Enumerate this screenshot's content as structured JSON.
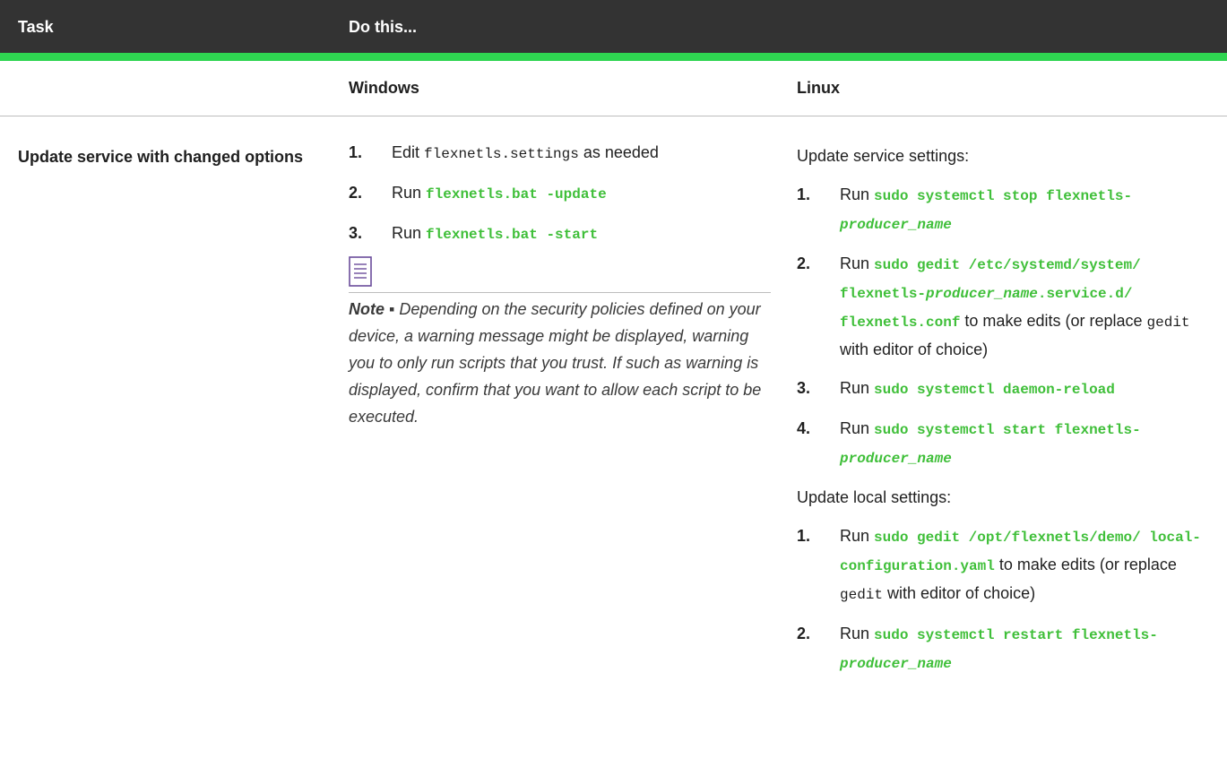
{
  "header": {
    "task": "Task",
    "do_this": "Do this..."
  },
  "subheader": {
    "windows": "Windows",
    "linux": "Linux"
  },
  "row": {
    "task_label": "Update service with changed options",
    "windows": {
      "steps": [
        {
          "num": "1.",
          "pre": "Edit ",
          "mono": "flexnetls.settings",
          "post": " as needed"
        },
        {
          "num": "2.",
          "pre": "Run ",
          "cmd": "flexnetls.bat -update"
        },
        {
          "num": "3.",
          "pre": "Run ",
          "cmd": "flexnetls.bat -start"
        }
      ],
      "note_label": "Note ▪",
      "note_text": " Depending on the security policies defined on your device, a warning message might be displayed, warning you to only run scripts that you trust. If such as warning is displayed, confirm that you want to allow each script to be executed."
    },
    "linux": {
      "service_heading": "Update service settings:",
      "service_steps": [
        {
          "num": "1.",
          "pre": "Run ",
          "cmd_a": "sudo systemctl stop flexnetls-",
          "cmd_i": "producer_name"
        },
        {
          "num": "2.",
          "pre": "Run ",
          "cmd_a": "sudo gedit /etc/systemd/system/ flexnetls-",
          "cmd_i": "producer_name",
          "cmd_b": ".service.d/ flexnetls.conf",
          "mid": " to make edits (or replace ",
          "mono": "gedit",
          "post": " with editor of choice)"
        },
        {
          "num": "3.",
          "pre": "Run ",
          "cmd_a": "sudo systemctl daemon-reload"
        },
        {
          "num": "4.",
          "pre": "Run ",
          "cmd_a": "sudo systemctl start flexnetls-",
          "cmd_i": "producer_name"
        }
      ],
      "local_heading": "Update local settings:",
      "local_steps": [
        {
          "num": "1.",
          "pre": "Run ",
          "cmd_a": "sudo gedit /opt/flexnetls/demo/ local-configuration.yaml",
          "mid": " to make edits (or replace ",
          "mono": "gedit",
          "post": " with editor of choice)"
        },
        {
          "num": "2.",
          "pre": "Run ",
          "cmd_a": "sudo systemctl restart flexnetls-",
          "cmd_i": "producer_name"
        }
      ]
    }
  },
  "icons": {
    "note": "note-icon"
  },
  "colors": {
    "header_bg": "#333333",
    "header_accent": "#2fd551",
    "command": "#3fbf39"
  }
}
